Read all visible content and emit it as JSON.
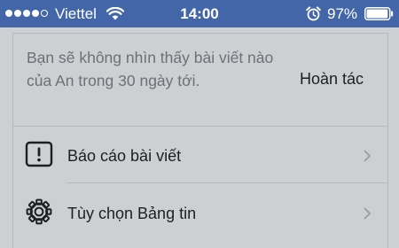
{
  "status_bar": {
    "signal_bars_filled": 4,
    "signal_bars_total": 5,
    "carrier": "Viettel",
    "wifi_icon": "wifi-icon",
    "time": "14:00",
    "alarm_icon": "alarm-clock-icon",
    "battery_percent_label": "97%",
    "battery_level": 0.97
  },
  "notice": {
    "text": "Bạn sẽ không nhìn thấy bài viết nào của An trong 30 ngày tới.",
    "undo_label": "Hoàn tác"
  },
  "menu": {
    "items": [
      {
        "label": "Báo cáo bài viết",
        "icon": "report-exclamation-icon"
      },
      {
        "label": "Tùy chọn Bảng tin",
        "icon": "gear-icon"
      }
    ]
  },
  "colors": {
    "status_bar_bg": "#4266a8",
    "background": "#cdcfd3",
    "text_primary": "#1d1f23",
    "text_secondary": "#6d7075",
    "divider": "#b6b8bd"
  }
}
